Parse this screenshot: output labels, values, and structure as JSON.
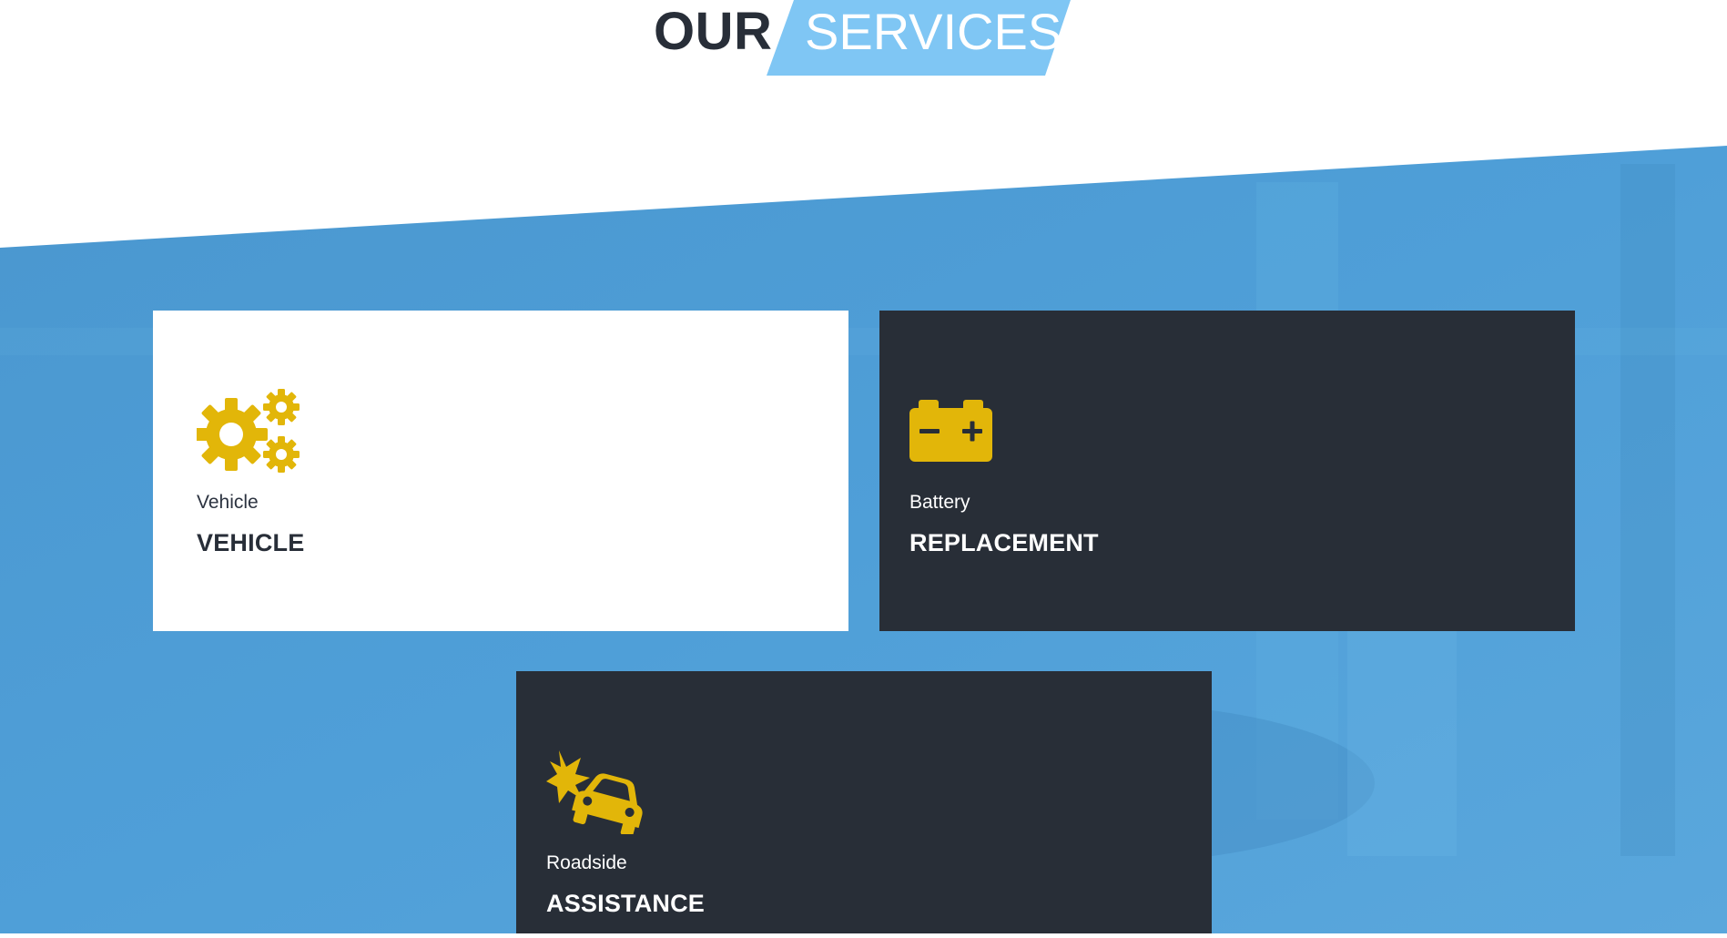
{
  "section": {
    "heading_part1": "OUR",
    "heading_part2": "SERVICES"
  },
  "colors": {
    "accent_blue": "#7fc6f4",
    "hero_blue": "#4f9fd8",
    "dark_card": "#282e37",
    "icon_yellow": "#e2b609",
    "heading_dark": "#282e38"
  },
  "services": [
    {
      "subtitle": "Vehicle",
      "title": "VEHICLE",
      "icon": "gears-icon",
      "theme": "light"
    },
    {
      "subtitle": "Battery",
      "title": "REPLACEMENT",
      "icon": "battery-icon",
      "theme": "dark"
    },
    {
      "subtitle": "Roadside",
      "title": "ASSISTANCE",
      "icon": "car-crash-icon",
      "theme": "dark"
    }
  ]
}
